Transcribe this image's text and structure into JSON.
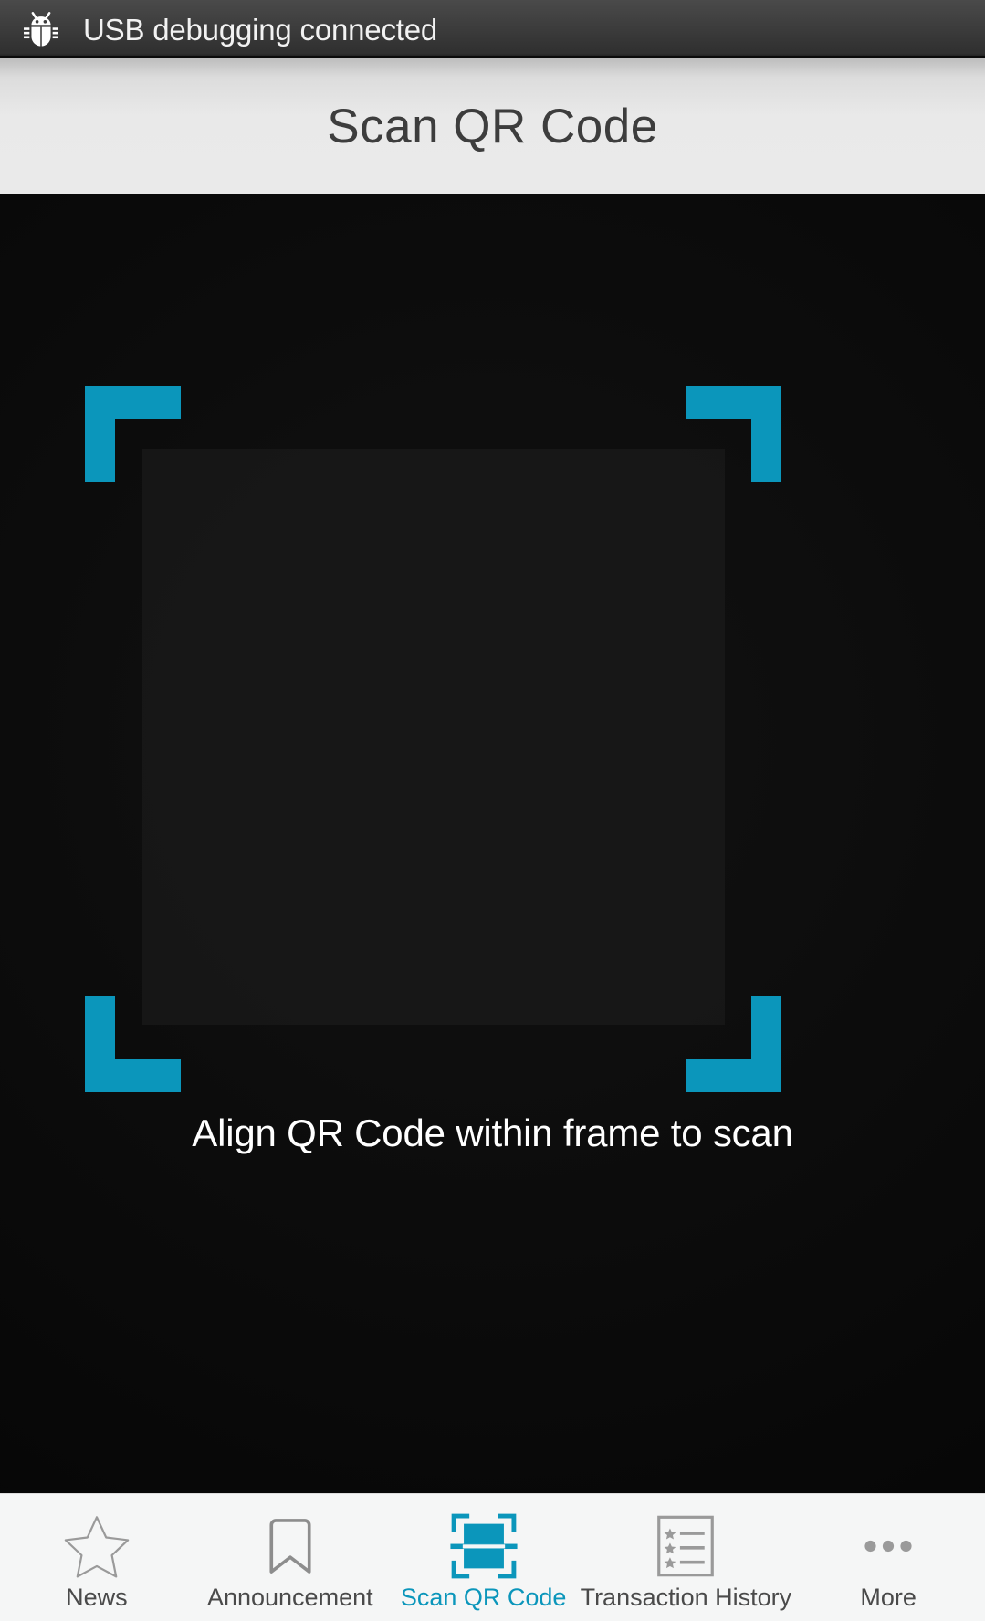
{
  "status_bar": {
    "icon": "android-debug-bug-icon",
    "text": "USB debugging connected",
    "background_color": "#3d3d3d",
    "text_color": "#f2f2f2"
  },
  "header": {
    "title": "Scan QR Code",
    "background_color": "#e9e9e9",
    "title_color": "#3d3d3d"
  },
  "scanner": {
    "instruction": "Align QR Code within frame to scan",
    "frame_color": "#0b96bb",
    "instruction_color": "#ffffff",
    "preview_background": "#050505",
    "corners": [
      {
        "name": "top-left"
      },
      {
        "name": "top-right"
      },
      {
        "name": "bottom-left"
      },
      {
        "name": "bottom-right"
      }
    ]
  },
  "tab_bar": {
    "background_color": "#f5f6f6",
    "active_color": "#0b96bb",
    "inactive_color": "#4a4a4a",
    "active_index": 2,
    "tabs": [
      {
        "label": "News",
        "icon": "star-outline-icon",
        "active": false
      },
      {
        "label": "Announcement",
        "icon": "bookmark-outline-icon",
        "active": false
      },
      {
        "label": "Scan QR Code",
        "icon": "qr-scan-icon",
        "active": true
      },
      {
        "label": "Transaction History",
        "icon": "starred-list-page-icon",
        "active": false
      },
      {
        "label": "More",
        "icon": "ellipsis-horizontal-icon",
        "active": false
      }
    ]
  }
}
